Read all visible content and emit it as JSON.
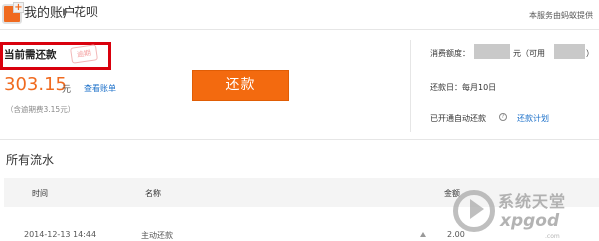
{
  "header": {
    "account": "我的账户",
    "current": "花呗",
    "provider_note": "本服务由蚂蚁提供"
  },
  "repayment": {
    "label": "当前需还款",
    "stamp": "逾期",
    "amount": "303.15",
    "unit": "元",
    "bill_link": "查看账单",
    "fee_note": "（含逾期费3.15元）",
    "button": "还款"
  },
  "info": {
    "quota_label": "消费额度：",
    "quota_unit": "元（可用",
    "quota_close": "）",
    "repay_day": "还款日：每月10日",
    "auto_repay": "已开通自动还款",
    "help_icon_text": "?",
    "plan_link": "还款计划"
  },
  "flows": {
    "title": "所有流水",
    "columns": [
      "时间",
      "名称",
      "金额"
    ],
    "rows": [
      {
        "time": "2014-12-13 14:44",
        "name": "主动还款",
        "amount": "2.00"
      }
    ]
  },
  "watermark": {
    "title": "系统天堂",
    "sub": "xpgod",
    "small": ".com"
  },
  "colors": {
    "accent": "#f36a0f",
    "link": "#1a6fc9",
    "highlight_border": "#d9000d"
  }
}
